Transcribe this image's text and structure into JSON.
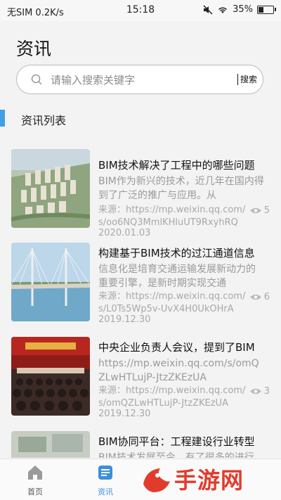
{
  "status_bar": {
    "carrier": "无SIM 0.2K/s",
    "time": "15:18",
    "battery": "35%",
    "battery_level": 0.35
  },
  "page": {
    "title": "资讯"
  },
  "search": {
    "placeholder": "请输入搜索关键字",
    "button": "搜索"
  },
  "section": {
    "title": "资讯列表"
  },
  "news": [
    {
      "title": "BIM技术解决了工程中的哪些问题",
      "summary": "BIM作为新兴的技术，近几年在国内得到了广泛的推广与应用。从",
      "source": "来源：https://mp.weixin.qq.com/s/oo6NQ3MmlKHluUT9RxyhRQ",
      "date": "2020.01.03",
      "views": "5"
    },
    {
      "title": "构建基于BIM技术的过江通道信息",
      "summary": "信息化是培育交通运输发展新动力的重要引擎，是新时期实现交通",
      "source": "来源：https://mp.weixin.qq.com/s/L0Ts5Wp5v-UvX4H0UkOHrA",
      "date": "2019.12.30",
      "views": "6"
    },
    {
      "title": "中央企业负责人会议，提到了BIM",
      "summary": "https://mp.weixin.qq.com/s/omQZLwHTLujP-JtzZKEzUA",
      "source": "来源：https://mp.weixin.qq.com/s/omQZLwHTLujP-JtzZKEzUA",
      "date": "2019.12.30",
      "views": "3"
    },
    {
      "title": "BIM协同平台：工程建设行业转型",
      "summary": "BIM技术发展至今，有了很多的进行",
      "source": "",
      "date": "",
      "views": ""
    }
  ],
  "tabs": [
    {
      "label": "首页",
      "icon": "home-icon",
      "active": false
    },
    {
      "label": "资讯",
      "icon": "news-icon",
      "active": true
    }
  ],
  "watermark": {
    "text": "手游网",
    "logo": "火鸟手游网"
  },
  "colors": {
    "accent": "#3ea0e4",
    "tab_active": "#3c8fd8",
    "watermark": "#e23b2e"
  }
}
